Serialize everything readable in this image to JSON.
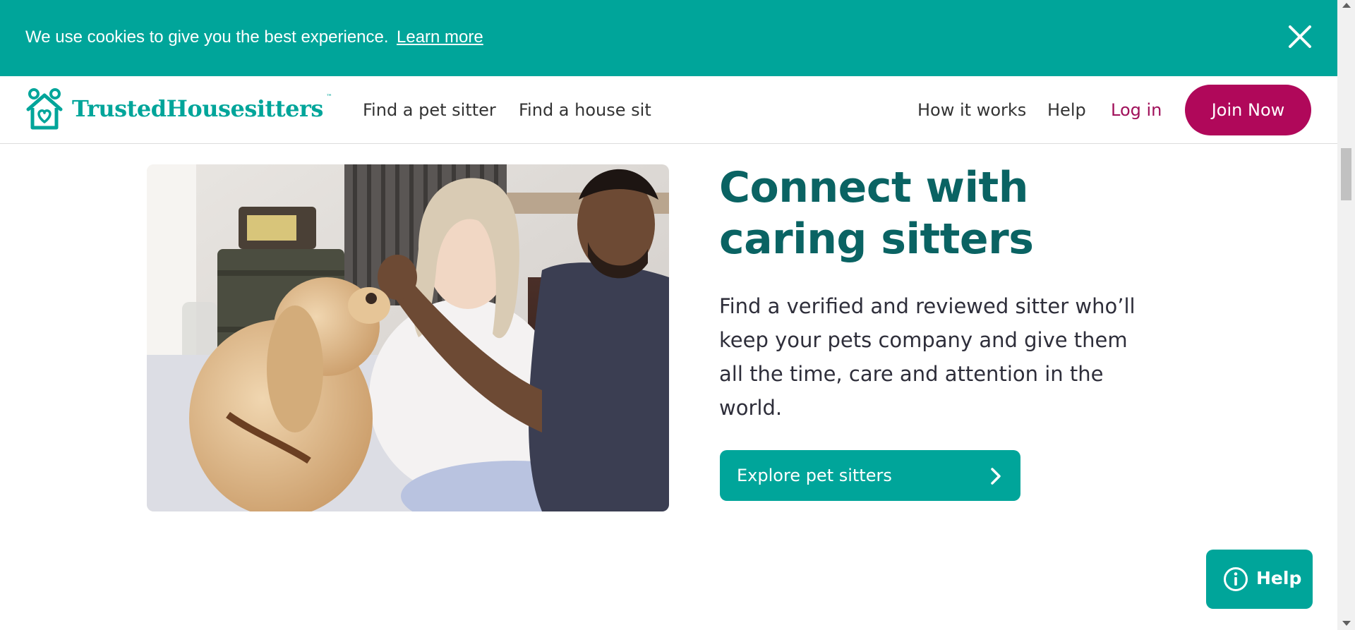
{
  "cookie_banner": {
    "message": "We use cookies to give you the best experience.",
    "link_label": "Learn more"
  },
  "header": {
    "logo_text": "TrustedHousesitters",
    "logo_tm": "™",
    "nav_left": [
      "Find a pet sitter",
      "Find a house sit"
    ],
    "nav_right": [
      "How it works",
      "Help"
    ],
    "login_label": "Log in",
    "join_label": "Join Now"
  },
  "hero": {
    "headline_line1": "Connect with",
    "headline_line2": "caring sitters",
    "body": "Find a verified and reviewed sitter who’ll keep your pets company and give them all the time, care and attention in the world.",
    "cta_label": "Explore pet sitters"
  },
  "help_widget": {
    "label": "Help"
  },
  "colors": {
    "teal": "#00a59a",
    "dark_teal": "#0a6363",
    "magenta": "#b0085a"
  }
}
